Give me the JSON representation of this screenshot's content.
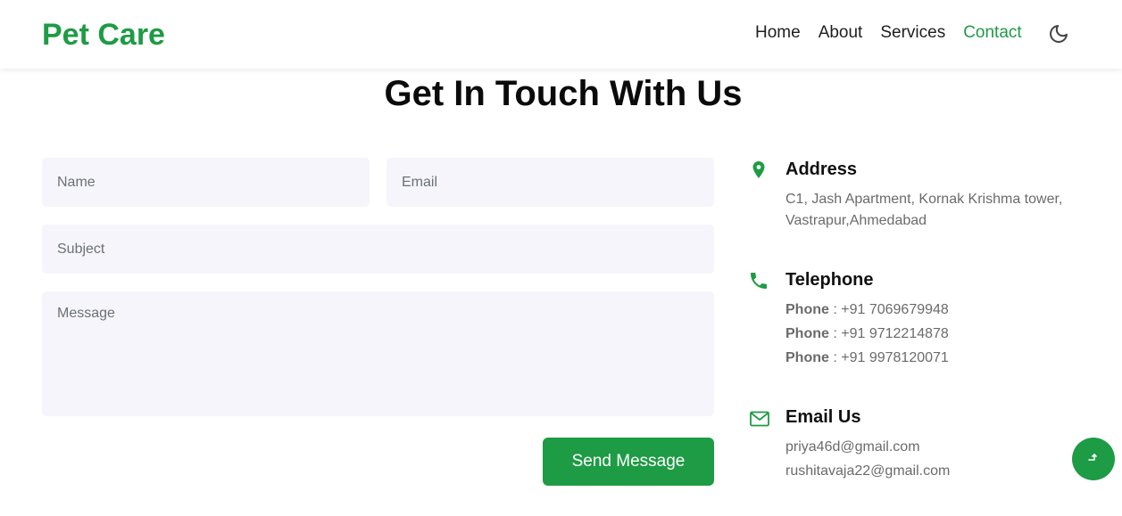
{
  "brand": "Pet Care",
  "nav": {
    "items": [
      {
        "label": "Home"
      },
      {
        "label": "About"
      },
      {
        "label": "Services"
      },
      {
        "label": "Contact"
      }
    ],
    "active": "Contact",
    "theme_toggle_icon": "moon-icon"
  },
  "page_title": "Get In Touch With Us",
  "form": {
    "name_placeholder": "Name",
    "email_placeholder": "Email",
    "subject_placeholder": "Subject",
    "message_placeholder": "Message",
    "submit_label": "Send Message"
  },
  "address": {
    "icon": "map-pin-icon",
    "heading": "Address",
    "line1": "C1, Jash Apartment, Kornak Krishma tower,",
    "line2": "Vastrapur,Ahmedabad"
  },
  "telephone": {
    "icon": "phone-icon",
    "heading": "Telephone",
    "label": "Phone",
    "numbers": [
      ": +91 7069679948",
      ": +91 9712214878",
      ": +91 9978120071"
    ]
  },
  "email": {
    "icon": "envelope-icon",
    "heading": "Email Us",
    "addresses": [
      "priya46d@gmail.com",
      "rushitavaja22@gmail.com"
    ]
  },
  "scroll_top_icon": "arrow-up-icon",
  "colors": {
    "accent": "#1e9b45",
    "field_bg": "#f5f5fb",
    "muted_text": "#6b6b6b"
  }
}
